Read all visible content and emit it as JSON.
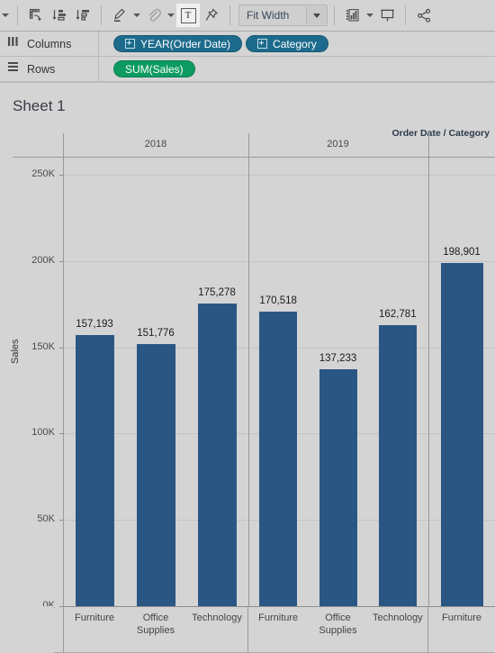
{
  "toolbar": {
    "items": [
      {
        "name": "sort-swap-icon",
        "label": "",
        "icon": "swap-reorder"
      },
      {
        "name": "sort-ascending-icon",
        "label": "",
        "icon": "sort-asc"
      },
      {
        "name": "sort-descending-icon",
        "label": "",
        "icon": "sort-desc"
      },
      {
        "name": "highlighter-icon",
        "label": "",
        "icon": "highlighter"
      },
      {
        "name": "attachment-icon",
        "label": "",
        "icon": "paperclip"
      },
      {
        "name": "text-annotation-icon",
        "label": "T",
        "icon": "text-box"
      },
      {
        "name": "pin-icon",
        "label": "",
        "icon": "pushpin"
      },
      {
        "name": "show-me-icon",
        "label": "",
        "icon": "show-me"
      },
      {
        "name": "presentation-mode-icon",
        "label": "",
        "icon": "presentation"
      },
      {
        "name": "share-icon",
        "label": "",
        "icon": "share"
      }
    ],
    "fit_selector": {
      "value": "Fit Width"
    }
  },
  "shelves": {
    "columns": {
      "label": "Columns",
      "pills": [
        {
          "text": "YEAR(Order Date)",
          "type": "dimension"
        },
        {
          "text": "Category",
          "type": "dimension"
        }
      ]
    },
    "rows": {
      "label": "Rows",
      "pills": [
        {
          "text": "SUM(Sales)",
          "type": "measure"
        }
      ]
    }
  },
  "worksheet": {
    "title": "Sheet 1",
    "column_header_caption": "Order Date / Category"
  },
  "chart_data": {
    "type": "bar",
    "title": "Sheet 1",
    "xlabel": "Order Date / Category",
    "ylabel": "Sales",
    "ylim": [
      0,
      260000
    ],
    "yticks": [
      0,
      50000,
      100000,
      150000,
      200000,
      250000
    ],
    "ytick_labels": [
      "0K",
      "50K",
      "100K",
      "150K",
      "200K",
      "250K"
    ],
    "grid": true,
    "legend": "none",
    "bar_color": "#2a5684",
    "group_field": "Order Date",
    "groups": [
      "2018",
      "2019",
      ""
    ],
    "categories": [
      "Furniture",
      "Office Supplies",
      "Technology",
      "Furniture",
      "Office Supplies",
      "Technology",
      "Furniture"
    ],
    "values": [
      157193,
      151776,
      175278,
      170518,
      137233,
      162781,
      198901
    ],
    "value_labels": [
      "157,193",
      "151,776",
      "175,278",
      "170,518",
      "137,233",
      "162,781",
      "198,901"
    ],
    "points": [
      {
        "group": "2018",
        "category": "Furniture",
        "value": 157193,
        "label": "157,193"
      },
      {
        "group": "2018",
        "category": "Office Supplies",
        "value": 151776,
        "label": "151,776"
      },
      {
        "group": "2018",
        "category": "Technology",
        "value": 175278,
        "label": "175,278"
      },
      {
        "group": "2019",
        "category": "Furniture",
        "value": 170518,
        "label": "170,518"
      },
      {
        "group": "2019",
        "category": "Office Supplies",
        "value": 137233,
        "label": "137,233"
      },
      {
        "group": "2019",
        "category": "Technology",
        "value": 162781,
        "label": "162,781"
      },
      {
        "group": "",
        "category": "Furniture",
        "value": 198901,
        "label": "198,901"
      }
    ]
  }
}
